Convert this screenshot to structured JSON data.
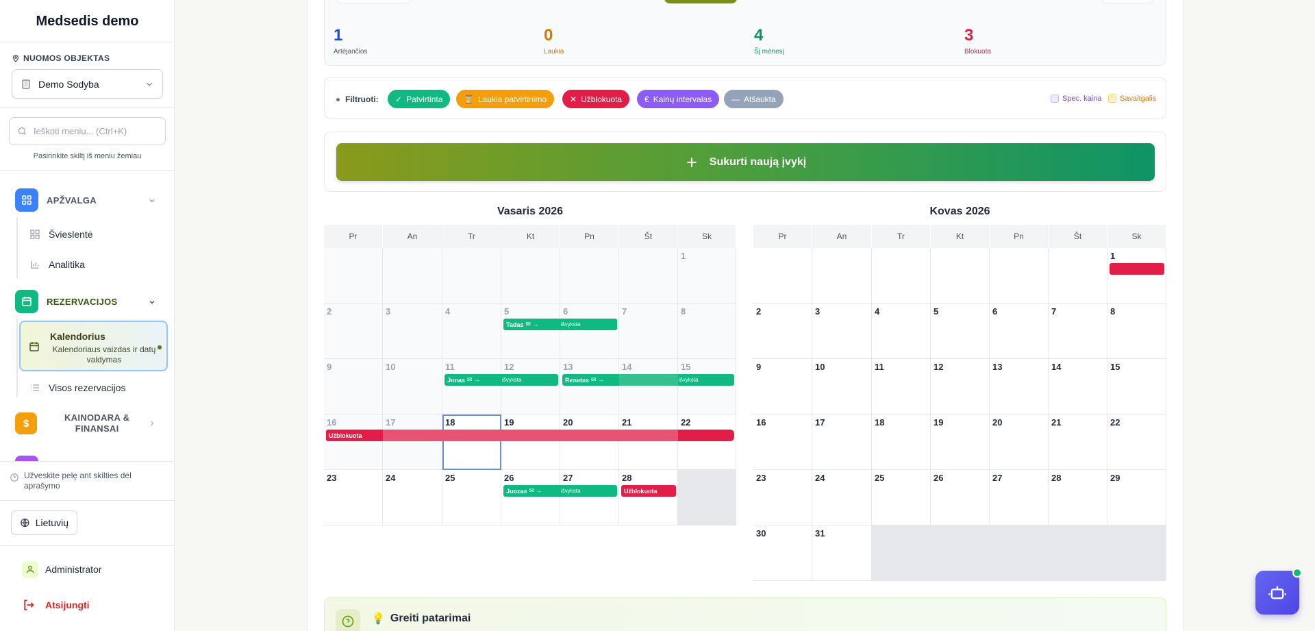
{
  "app": {
    "title": "Medsedis demo"
  },
  "property": {
    "label": "NUOMOS OBJEKTAS",
    "selected": "Demo Sodyba"
  },
  "search": {
    "placeholder": "Ieškoti meniu... (Ctrl+K)",
    "hint": "Pasirinkite skiltį iš meniu žemiau"
  },
  "nav": {
    "overview": {
      "label": "APŽVALGA",
      "color": "#3b82f6",
      "items": [
        "Švieslentė",
        "Analitika"
      ]
    },
    "reservations": {
      "label": "REZERVACIJOS",
      "color": "#10b981",
      "active": {
        "label": "Kalendorius",
        "desc": "Kalendoriaus vaizdas ir datų valdymas"
      },
      "items": [
        "Visos rezervacijos"
      ]
    },
    "pricing": {
      "label_line1": "KAINODARA &",
      "label_line2": "FINANSAI",
      "color": "#f59e0b"
    }
  },
  "hover_hint": "Užveskite pelę ant skilties dėl aprašymo",
  "language": "Lietuvių",
  "user": {
    "name": "Administrator"
  },
  "logout": "Atsijungti",
  "stats": [
    {
      "value": "1",
      "label": "Artėjančios",
      "color": "#1d4ed8"
    },
    {
      "value": "0",
      "label": "Laukia",
      "color": "#d97706"
    },
    {
      "value": "4",
      "label": "Šį mėnesį",
      "color": "#059669"
    },
    {
      "value": "3",
      "label": "Blokuota",
      "color": "#e11d48"
    }
  ],
  "filters": {
    "label": "Filtruoti:",
    "chips": [
      {
        "icon": "✓",
        "label": "Patvirtinta",
        "color": "#10b981"
      },
      {
        "icon": "⌛",
        "label": "Laukia patvirtinimo",
        "color": "#f59e0b"
      },
      {
        "icon": "✕",
        "label": "Užblokuota",
        "color": "#e11d48"
      },
      {
        "icon": "€",
        "label": "Kainų intervalas",
        "color": "#8b5cf6"
      },
      {
        "icon": "—",
        "label": "Atšaukta",
        "color": "#94a3b8"
      }
    ],
    "legend": [
      {
        "label": "Spec. kaina",
        "color": "#7c3aed",
        "fill": "#ede9fe"
      },
      {
        "label": "Savaitgalis",
        "color": "#d97706",
        "fill": "#fef3c7"
      }
    ]
  },
  "create_button": "Sukurti naują įvykį",
  "weekdays": [
    "Pr",
    "An",
    "Tr",
    "Kt",
    "Pn",
    "Št",
    "Sk"
  ],
  "months": [
    {
      "title": "Vasaris 2026",
      "weeks": [
        [
          "",
          "",
          "",
          "",
          "",
          "",
          "1"
        ],
        [
          "2",
          "3",
          "4",
          "5",
          "6",
          "7",
          "8"
        ],
        [
          "9",
          "10",
          "11",
          "12",
          "13",
          "14",
          "15"
        ],
        [
          "16",
          "17",
          "18",
          "19",
          "20",
          "21",
          "22"
        ],
        [
          "23",
          "24",
          "25",
          "26",
          "27",
          "28",
          ""
        ]
      ],
      "past_until": 17,
      "today": 18,
      "events": [
        {
          "week": 1,
          "start": 3,
          "end": 4,
          "text": "Tadas",
          "end_text": "išvyksta",
          "status": "confirmed"
        },
        {
          "week": 2,
          "start": 2,
          "end": 3,
          "text": "Jonas",
          "end_text": "išvyksta",
          "status": "confirmed"
        },
        {
          "week": 2,
          "start": 4,
          "end": 6,
          "text": "Renatas",
          "end_text": "išvyksta",
          "status": "confirmed"
        },
        {
          "week": 3,
          "start": 0,
          "end": 6,
          "text": "Užblokuota",
          "end_text": "",
          "status": "blocked"
        },
        {
          "week": 4,
          "start": 3,
          "end": 4,
          "text": "Juozas",
          "end_text": "išvyksta",
          "status": "confirmed"
        },
        {
          "week": 4,
          "start": 5,
          "end": 5,
          "text": "Užblokuota",
          "end_text": "",
          "status": "blocked"
        }
      ]
    },
    {
      "title": "Kovas 2026",
      "weeks": [
        [
          "",
          "",
          "",
          "",
          "",
          "",
          "1"
        ],
        [
          "2",
          "3",
          "4",
          "5",
          "6",
          "7",
          "8"
        ],
        [
          "9",
          "10",
          "11",
          "12",
          "13",
          "14",
          "15"
        ],
        [
          "16",
          "17",
          "18",
          "19",
          "20",
          "21",
          "22"
        ],
        [
          "23",
          "24",
          "25",
          "26",
          "27",
          "28",
          "29"
        ],
        [
          "30",
          "31",
          "",
          "",
          "",
          "",
          ""
        ]
      ],
      "past_until": 0,
      "today": 0,
      "events": [
        {
          "week": 0,
          "start": 6,
          "end": 6,
          "text": "",
          "end_text": "",
          "status": "blocked"
        }
      ]
    }
  ],
  "tips": {
    "title": "Greiti patarimai"
  }
}
